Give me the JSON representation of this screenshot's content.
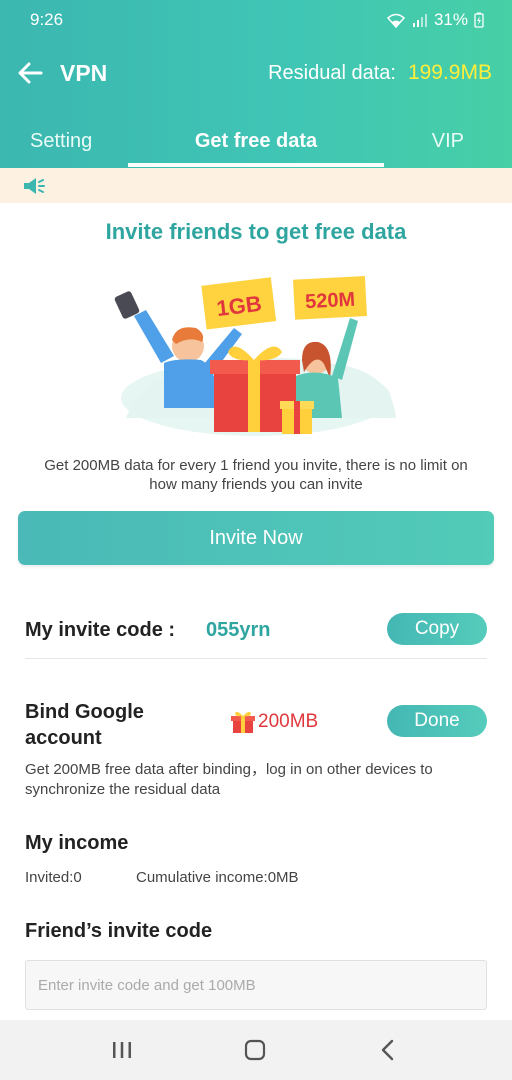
{
  "status_bar": {
    "time": "9:26",
    "battery": "31%"
  },
  "header": {
    "title": "VPN",
    "residual_label": "Residual data:",
    "residual_value": "199.9MB"
  },
  "tabs": [
    {
      "label": "Setting",
      "active": false
    },
    {
      "label": "Get free data",
      "active": true
    },
    {
      "label": "VIP",
      "active": false
    }
  ],
  "promo": {
    "heading": "Invite friends to get free data",
    "illustration_signs": [
      "1GB",
      "520M"
    ],
    "description": "Get 200MB data for every 1 friend you invite, there is no limit on how many friends you can invite",
    "invite_button": "Invite Now"
  },
  "invite_code": {
    "label": "My invite code :",
    "value": "055yrn",
    "copy_button": "Copy"
  },
  "bind_google": {
    "label": "Bind Google account",
    "reward": "200MB",
    "done_button": "Done",
    "description": "Get 200MB free data after binding，log in on other devices to synchronize the residual data"
  },
  "income": {
    "title": "My income",
    "invited": "Invited:0",
    "cumulative": "Cumulative income:0MB"
  },
  "friend_code": {
    "title": "Friend’s invite code",
    "placeholder": "Enter invite code and get 100MB"
  },
  "colors": {
    "accent": "#2fa5a0",
    "header_start": "#3bb7b0",
    "header_end": "#47cfa6",
    "residual_value": "#ffee3a",
    "reward_red": "#e0373c",
    "notice_bg": "#fdf1e2"
  },
  "icons": {
    "back": "arrow-left-icon",
    "notice": "speaker-icon",
    "reward": "gift-icon",
    "nav": [
      "recent-apps-icon",
      "home-icon",
      "back-icon"
    ]
  }
}
